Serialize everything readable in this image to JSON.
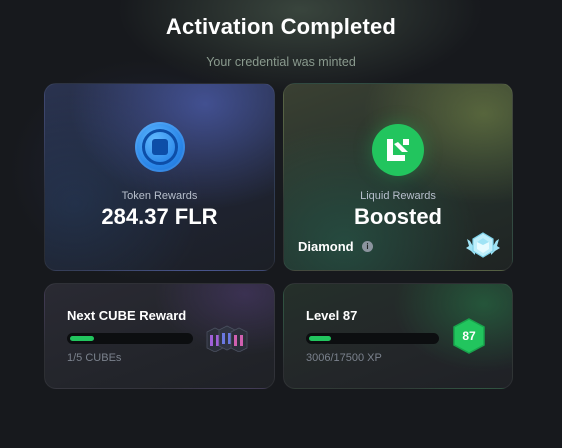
{
  "header": {
    "title": "Activation Completed",
    "subtitle": "Your credential was minted"
  },
  "token_card": {
    "label": "Token Rewards",
    "value": "284.37 FLR",
    "icon": "flare-coin-icon"
  },
  "liquid_card": {
    "label": "Liquid Rewards",
    "value": "Boosted",
    "icon": "liquid-logo-icon",
    "tier": "Diamond",
    "tier_icon": "diamond-badge-icon"
  },
  "cube_card": {
    "title": "Next CUBE Reward",
    "progress_text": "1/5 CUBEs",
    "progress_fraction": 0.2,
    "icon": "cubes-icon"
  },
  "level_card": {
    "title": "Level 87",
    "progress_text": "3006/17500 XP",
    "progress_fraction": 0.172,
    "badge_value": "87",
    "icon": "level-hexagon-icon"
  },
  "colors": {
    "accent_green": "#22c55e",
    "coin_blue": "#2a86e8",
    "background": "#17191d"
  }
}
